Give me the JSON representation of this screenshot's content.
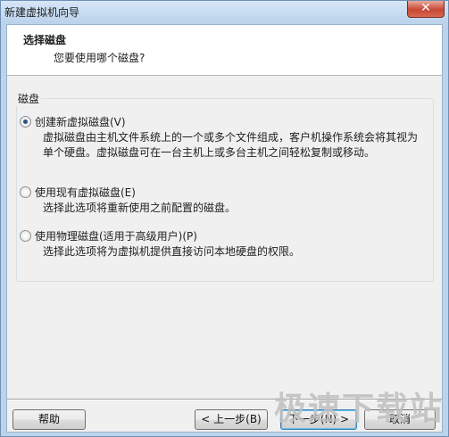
{
  "window": {
    "title": "新建虚拟机向导",
    "close_label": "✕"
  },
  "header": {
    "title": "选择磁盘",
    "subtitle": "您要使用哪个磁盘?"
  },
  "group": {
    "label": "磁盘",
    "options": [
      {
        "label": "创建新虚拟磁盘(V)",
        "checked": true,
        "description": "虚拟磁盘由主机文件系统上的一个或多个文件组成，客户机操作系统会将其视为单个硬盘。虚拟磁盘可在一台主机上或多台主机之间轻松复制或移动。"
      },
      {
        "label": "使用现有虚拟磁盘(E)",
        "checked": false,
        "description": "选择此选项将重新使用之前配置的磁盘。"
      },
      {
        "label": "使用物理磁盘(适用于高级用户)(P)",
        "checked": false,
        "description": "选择此选项将为虚拟机提供直接访问本地硬盘的权限。"
      }
    ]
  },
  "buttons": {
    "help": "帮助",
    "back": "< 上一步(B)",
    "next": "下一步(N) >",
    "cancel": "取消"
  },
  "watermark": "极速下载站",
  "colors": {
    "titlebar": "#bcd3ec",
    "client_bg": "#f0f0f0",
    "close_button": "#c74734"
  }
}
